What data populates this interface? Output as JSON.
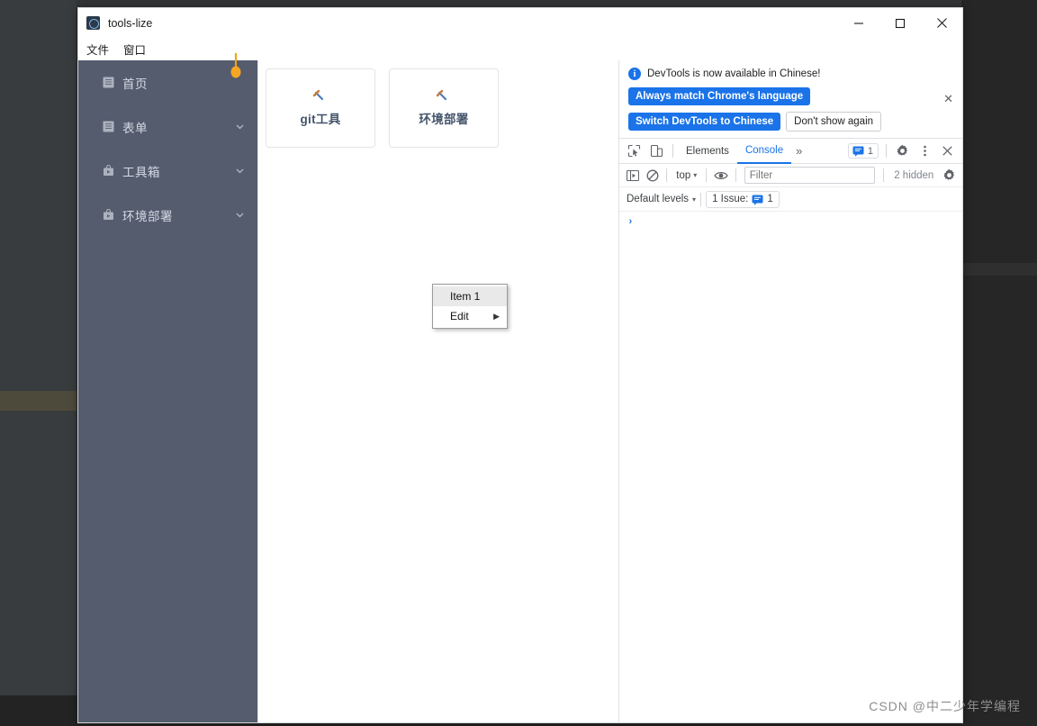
{
  "window": {
    "title": "tools-lize",
    "app_icon": "app-logo-icon",
    "controls": {
      "minimize": "—",
      "maximize": "□",
      "close": "✕"
    }
  },
  "menubar": {
    "items": [
      {
        "label": "文件"
      },
      {
        "label": "窗口"
      }
    ]
  },
  "sidebar": {
    "pin_icon": "orange-pin-icon",
    "background": "#545c6e",
    "items": [
      {
        "label": "首页",
        "icon": "document-icon",
        "has_chevron": false
      },
      {
        "label": "表单",
        "icon": "document-icon",
        "has_chevron": true
      },
      {
        "label": "工具箱",
        "icon": "briefcase-icon",
        "has_chevron": true
      },
      {
        "label": "环境部署",
        "icon": "briefcase-icon",
        "has_chevron": true
      }
    ]
  },
  "main": {
    "cards": [
      {
        "label": "git工具",
        "icon": "hammer-icon"
      },
      {
        "label": "环境部署",
        "icon": "hammer-icon"
      }
    ],
    "context_menu": {
      "items": [
        {
          "label": "Item 1",
          "hovered": true,
          "has_submenu": false
        },
        {
          "label": "Edit",
          "hovered": false,
          "has_submenu": true,
          "submenu_arrow": "▶"
        }
      ]
    }
  },
  "devtools": {
    "banner": {
      "icon": "info-icon",
      "message": "DevTools is now available in Chinese!",
      "primary_button": "Always match Chrome's language",
      "secondary_button": "Switch DevTools to Chinese",
      "tertiary_button": "Don't show again",
      "close": "✕",
      "accent_color": "#1a73e8"
    },
    "toolbar": {
      "inspect_icon": "inspect-cursor-icon",
      "device_icon": "device-toolbar-icon",
      "tabs": [
        {
          "label": "Elements",
          "active": false
        },
        {
          "label": "Console",
          "active": true
        }
      ],
      "overflow": "»",
      "message_badge": {
        "icon": "message-icon",
        "count": "1"
      },
      "settings_icon": "gear-icon",
      "more_icon": "kebab-menu-icon",
      "close_icon": "close-icon"
    },
    "filterbar": {
      "sidebar_icon": "console-sidebar-icon",
      "clear_icon": "clear-console-icon",
      "context": "top",
      "caret": "▾",
      "eye_icon": "live-expression-icon",
      "filter_placeholder": "Filter",
      "filter_value": "",
      "hidden_label": "2 hidden",
      "settings_icon": "console-settings-icon"
    },
    "levelsbar": {
      "levels": "Default levels",
      "caret": "▾",
      "issues_label": "1 Issue:",
      "issues_icon": "message-icon",
      "issues_count": "1"
    },
    "console": {
      "prompt": "›"
    }
  },
  "watermark": {
    "text": "CSDN @中二少年学编程"
  }
}
